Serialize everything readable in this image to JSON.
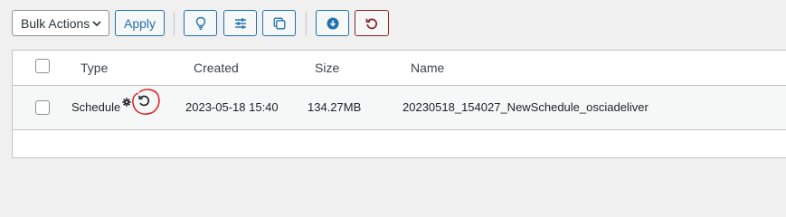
{
  "toolbar": {
    "bulk_actions_label": "Bulk Actions",
    "apply_label": "Apply",
    "icons": [
      "lightbulb-icon",
      "sliders-icon",
      "copy-icon",
      "download-icon",
      "restore-icon"
    ],
    "restore_color": "#8a2424",
    "accent_color": "#2271b1"
  },
  "table": {
    "headers": {
      "type": "Type",
      "created": "Created",
      "size": "Size",
      "name": "Name"
    },
    "rows": [
      {
        "type": "Schedule",
        "created": "2023-05-18 15:40",
        "size": "134.27MB",
        "name": "20230518_154027_NewSchedule_osciadeliver",
        "icons": [
          "gear-icon",
          "restore-icon"
        ],
        "annotation_color": "#e01010"
      }
    ]
  }
}
